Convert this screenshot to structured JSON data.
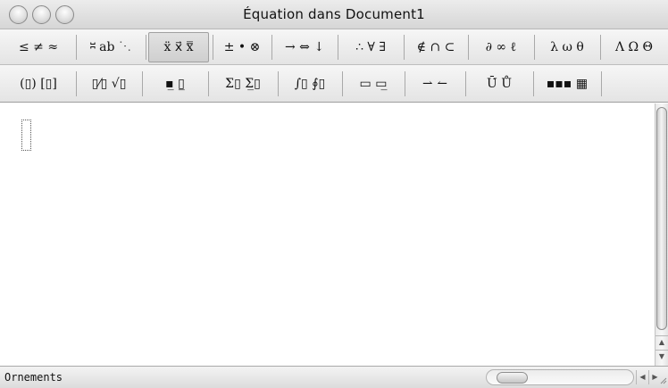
{
  "window": {
    "title": "Équation dans Document1"
  },
  "palette": {
    "row1": [
      "≤ ≠ ≈",
      "⎶ ab ⋱",
      "ẍ x⃗ x̿",
      "± • ⊗",
      "→ ⇔ ↓",
      "∴ ∀ ∃",
      "∉ ∩ ⊂",
      "∂ ∞ ℓ",
      "λ ω θ",
      "Λ Ω Θ"
    ],
    "row2": [
      "(▯) [▯]",
      "▯⁄▯ √▯",
      "▪̲ ▯̲",
      "Σ▯ Σ̲▯",
      "∫▯ ∮▯",
      "▭ ▭̲",
      "⇀ ↼",
      "Ū̇ Ů",
      "▪▪▪ ▦"
    ]
  },
  "status": {
    "text": "Ornements"
  },
  "icons": {
    "close": "close-icon",
    "minimize": "minimize-icon",
    "zoom": "zoom-icon",
    "scroll_up": "up-arrow-icon",
    "scroll_down": "down-arrow-icon",
    "scroll_left": "left-arrow-icon",
    "scroll_right": "right-arrow-icon",
    "resize": "resize-grip-icon"
  }
}
